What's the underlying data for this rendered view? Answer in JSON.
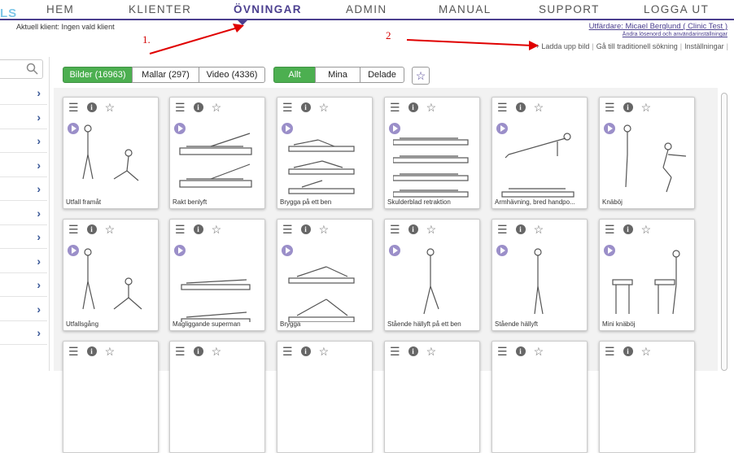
{
  "nav": {
    "logo": "LS",
    "items": [
      "HEM",
      "KLIENTER",
      "ÖVNINGAR",
      "ADMIN",
      "MANUAL",
      "SUPPORT",
      "LOGGA UT"
    ],
    "active_index": 2
  },
  "header": {
    "client": "Aktuell klient: Ingen vald klient",
    "executor": "Utfärdare: Micael Berglund ( Clinic Test )",
    "password_link": "Ändra lösenord och användarinställningar",
    "upload": "+ Ladda upp bild",
    "traditional_search": "Gå till traditionell sökning",
    "settings": "Inställningar"
  },
  "annotations": [
    "1.",
    "2"
  ],
  "accent_color": "#4b3f8f",
  "tab_color": "#4caf50",
  "tabs": {
    "images": "Bilder (16963)",
    "templates": "Mallar (297)",
    "video": "Video (4336)",
    "all": "Allt",
    "mine": "Mina",
    "shared": "Delade"
  },
  "icons": {
    "search": "search-icon",
    "star": "star-icon",
    "menu": "menu-icon",
    "info": "info-icon",
    "play": "play-icon"
  },
  "sidebar_rows": 11,
  "exercises": [
    "Utfall framåt",
    "Rakt benlyft",
    "Brygga på ett ben",
    "Skulderblad retraktion",
    "Armhävning, bred handpo...",
    "Knäböj",
    "Utfallsgång",
    "Magliggande superman",
    "Brygga",
    "Stående hällyft på ett ben",
    "Stående hällyft",
    "Mini knäböj",
    "",
    "",
    "",
    "",
    "",
    ""
  ]
}
